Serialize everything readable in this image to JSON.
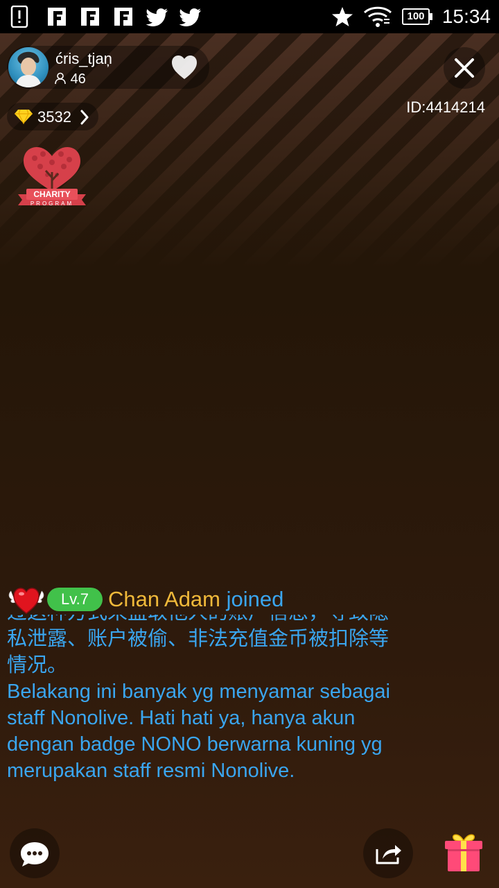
{
  "status_bar": {
    "time": "15:34",
    "battery": "100",
    "icons": [
      "alert-icon",
      "flipboard-icon",
      "flipboard-icon",
      "flipboard-icon",
      "twitter-icon",
      "twitter-icon",
      "star-icon",
      "wifi-icon",
      "battery-icon"
    ]
  },
  "host": {
    "name": "ćris_tjaņ",
    "viewer_count": "46"
  },
  "room": {
    "id_label": "ID:4414214",
    "diamonds": "3532"
  },
  "charity": {
    "line1": "CHARITY",
    "line2": "PROGRAM"
  },
  "join_notice": {
    "level": "Lv.7",
    "user": "Chan Adam",
    "action": "joined"
  },
  "chat": {
    "cut_line": "过这种方式来盗取他人的账户信息，导致隐",
    "cn_message": "私泄露、账户被偷、非法充值金币被扣除等情况。",
    "id_message": "Belakang ini banyak yg menyamar sebagai staff Nonolive. Hati hati ya, hanya akun dengan badge NONO berwarna kuning yg merupakan staff resmi Nonolive."
  },
  "colors": {
    "chat_text": "#3aa6f0",
    "join_name": "#f0b93a",
    "level_badge": "#41c14a",
    "charity_red": "#d6404a"
  }
}
